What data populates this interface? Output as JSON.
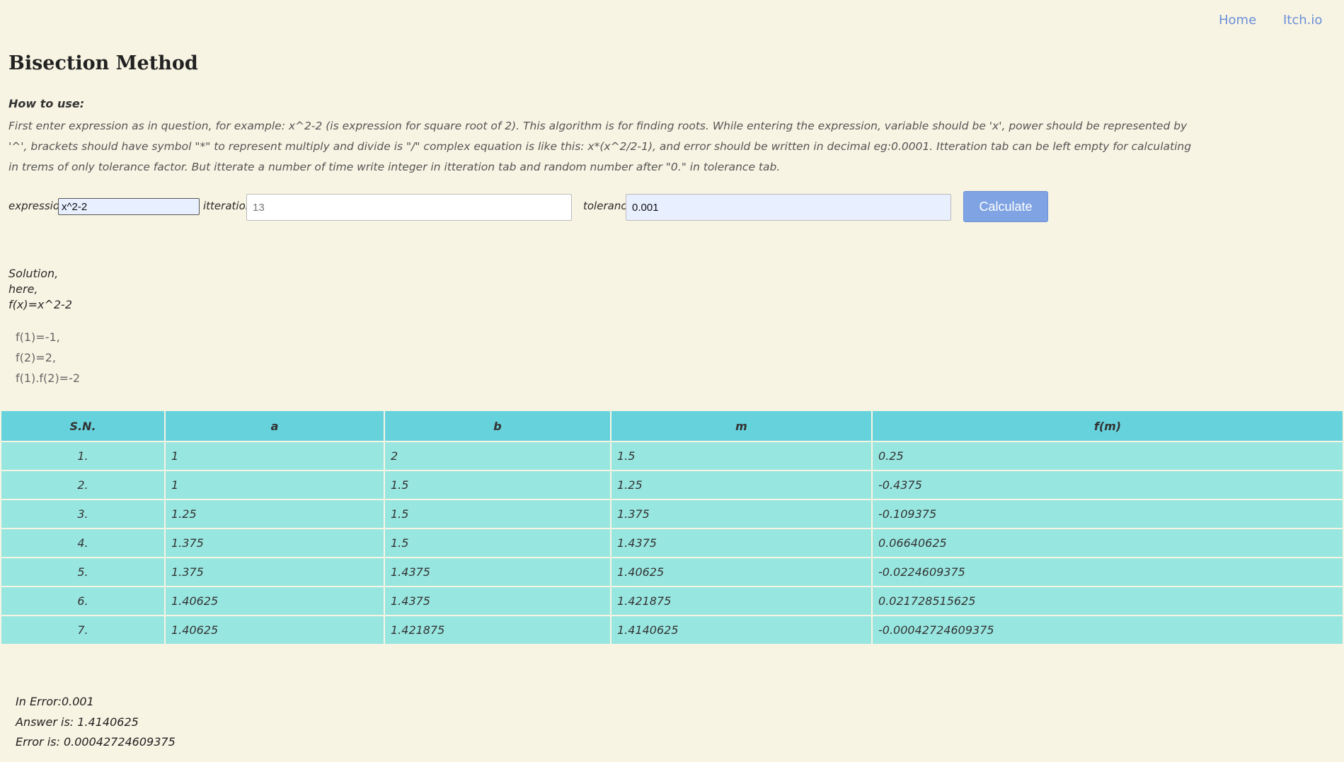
{
  "nav": {
    "home": "Home",
    "itch": "Itch.io"
  },
  "title": "Bisection Method",
  "howto": {
    "heading": "How to use:",
    "text": "First enter expression as in question, for example: x^2-2 (is expression for square root of 2). This algorithm is for finding roots. While entering the expression, variable should be 'x', power should be represented by '^', brackets should have symbol \"*\" to represent multiply and divide is \"/\" complex equation is like this: x*(x^2/2-1), and error should be written in decimal eg:0.0001. Itteration tab can be left empty for calculating in trems of only tolerance factor. But itterate a number of time write integer in itteration tab and random number after \"0.\" in tolerance tab."
  },
  "form": {
    "expression_label": "expression:",
    "expression_value": "x^2-2",
    "iteration_label": "itteration:",
    "iteration_placeholder": "13",
    "tolerance_label": "tolerance:",
    "tolerance_value": "0.001",
    "calculate_label": "Calculate"
  },
  "solution": {
    "line1": "Solution,",
    "line2": "here,",
    "line3": "f(x)=x^2-2",
    "f1": "f(1)=-1,",
    "f2": "f(2)=2,",
    "f1f2": "f(1).f(2)=-2"
  },
  "table": {
    "headers": [
      "S.N.",
      "a",
      "b",
      "m",
      "f(m)"
    ],
    "rows": [
      [
        "1.",
        "1",
        "2",
        "1.5",
        "0.25"
      ],
      [
        "2.",
        "1",
        "1.5",
        "1.25",
        "-0.4375"
      ],
      [
        "3.",
        "1.25",
        "1.5",
        "1.375",
        "-0.109375"
      ],
      [
        "4.",
        "1.375",
        "1.5",
        "1.4375",
        "0.06640625"
      ],
      [
        "5.",
        "1.375",
        "1.4375",
        "1.40625",
        "-0.0224609375"
      ],
      [
        "6.",
        "1.40625",
        "1.4375",
        "1.421875",
        "0.021728515625"
      ],
      [
        "7.",
        "1.40625",
        "1.421875",
        "1.4140625",
        "-0.00042724609375"
      ]
    ]
  },
  "results": {
    "error_in": "In Error:0.001",
    "answer": "Answer is: 1.4140625",
    "error": "Error is: 0.00042724609375"
  }
}
